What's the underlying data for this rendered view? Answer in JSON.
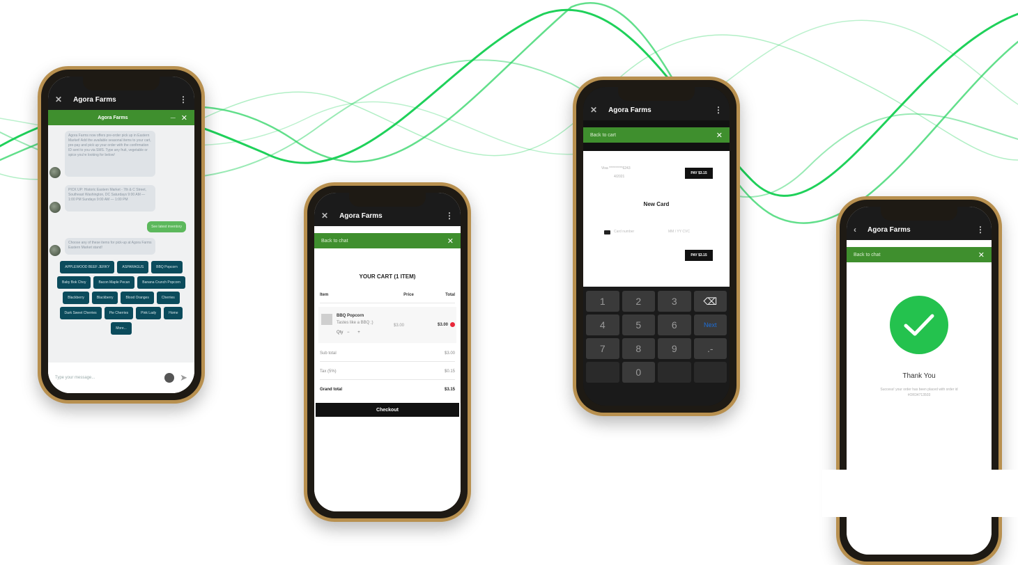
{
  "brand": {
    "accent": "#3f8f2e",
    "wave": "#1fd15a",
    "frame": "#b8904f",
    "chip": "#0b4b5c",
    "success": "#24c24e"
  },
  "app_title": "Agora Farms",
  "chat_screen": {
    "header_title": "Agora Farms",
    "messages": [
      "Agora Farms now offers pre-order pick up in Eastern Market! Add the available seasonal items to your cart, pre-pay and pick up your order with the confirmation ID sent to you via SMS. Type any fruit, vegetable or spice you're looking for below!",
      "PICK UP: Historic Eastern Market - 7th & C Street, Southeast Washington, DC Saturdays 9:00 AM — 1:00 PM Sundays 9:00 AM — 1:00 PM",
      "Choose any of these items for pick-up at Agora Farms Eastern Market stand!"
    ],
    "outgoing": "See latest inventory",
    "chips": [
      "APPLEWOOD BEEF JERKY",
      "ASPARAGUS",
      "BBQ Popcorn",
      "Baby Bok Choy",
      "Bacon Maple Pecan",
      "Banana Crunch Popcorn",
      "Blackberry",
      "Blackberry",
      "Blood Oranges",
      "Cherries",
      "Dark Sweet Cherries",
      "Pie Cherries",
      "Pink Lady",
      "Home",
      "More..."
    ],
    "composer_placeholder": "Type your message...",
    "mic_icon": "mic-icon",
    "send_icon": "send-icon"
  },
  "cart_screen": {
    "back_label": "Back to chat",
    "title": "YOUR CART (1 ITEM)",
    "columns": {
      "item": "Item",
      "price": "Price",
      "total": "Total"
    },
    "item": {
      "name": "BBQ Popcorn",
      "desc": "Tastes like a BBQ ;)",
      "qty_label": "Qty",
      "price": "$3.00",
      "total": "$3.00"
    },
    "subtotal": {
      "label": "Sub total",
      "value": "$3.00"
    },
    "tax": {
      "label": "Tax (5%)",
      "value": "$0.15"
    },
    "grand": {
      "label": "Grand total",
      "value": "$3.15"
    },
    "checkout": "Checkout"
  },
  "card_screen": {
    "back_label": "Back to cart",
    "saved_card": "Visa **********6243",
    "saved_exp": "4/2021",
    "pay_label": "PAY $3.15",
    "new_card": "New Card",
    "card_placeholder": "Card number",
    "exp_placeholder": "MM / YY CVC",
    "keys": [
      "1",
      "2",
      "3",
      "⌫",
      "4",
      "5",
      "6",
      "Next",
      "7",
      "8",
      "9",
      ".-",
      "",
      "0",
      "",
      ""
    ]
  },
  "thanks_screen": {
    "back_label": "Back to chat",
    "title": "Thank You",
    "message": "Success! your order has been placed with order id #OR34713503"
  }
}
